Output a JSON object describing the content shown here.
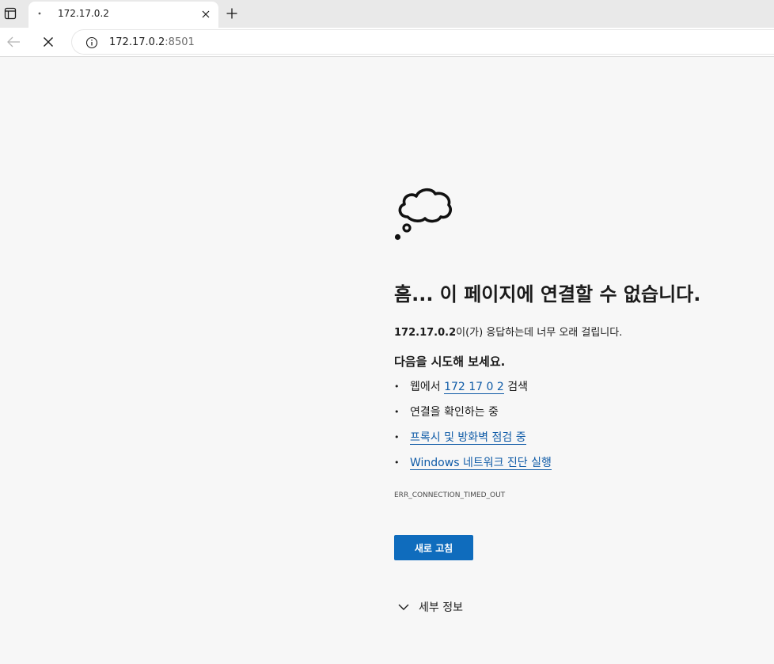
{
  "browser": {
    "tab": {
      "title": "172.17.0.2"
    },
    "address": {
      "host": "172.17.0.2",
      "port": ":8501"
    }
  },
  "error_page": {
    "headline": "흠... 이 페이지에 연결할 수 없습니다.",
    "description": {
      "host": "172.17.0.2",
      "message": "이(가) 응답하는데 너무 오래 걸립니다."
    },
    "suggestions_title": "다음을 시도해 보세요.",
    "suggestions": {
      "search_prefix": "웹에서 ",
      "search_link": "172 17 0 2",
      "search_suffix": " 검색",
      "check_connection": "연결을 확인하는 중",
      "check_proxy": "프록시 및 방화벽 점검 중",
      "run_diagnostics": "Windows 네트워크 진단 실행"
    },
    "error_code": "ERR_CONNECTION_TIMED_OUT",
    "refresh_label": "새로 고침",
    "details_label": "세부 정보"
  },
  "colors": {
    "accent": "#0f6cbd",
    "link": "#0f5ba7",
    "page_background": "#f7f7f7"
  },
  "icons": {
    "tab_actions": "tab-actions-icon",
    "favicon": "favicon-dot-icon",
    "tab_close": "close-icon",
    "new_tab": "plus-icon",
    "back": "arrow-left-icon",
    "stop": "stop-x-icon",
    "site_info": "info-icon",
    "error_illustration": "thought-cloud-icon",
    "details": "chevron-down-icon"
  }
}
